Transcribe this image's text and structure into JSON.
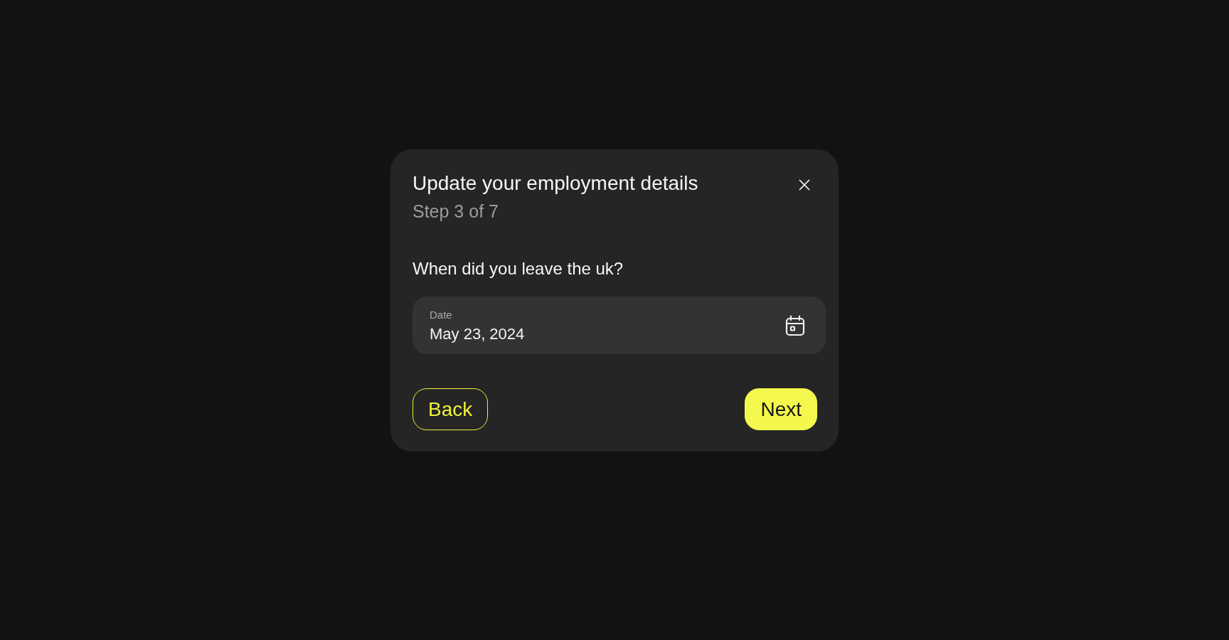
{
  "dialog": {
    "title": "Update your employment details",
    "step": "Step 3 of 7"
  },
  "question": "When did you leave the uk?",
  "date_field": {
    "label": "Date",
    "value": "May 23, 2024"
  },
  "buttons": [
    {
      "label": "Back",
      "kind": "secondary"
    },
    {
      "label": "Next",
      "kind": "primary"
    }
  ]
}
